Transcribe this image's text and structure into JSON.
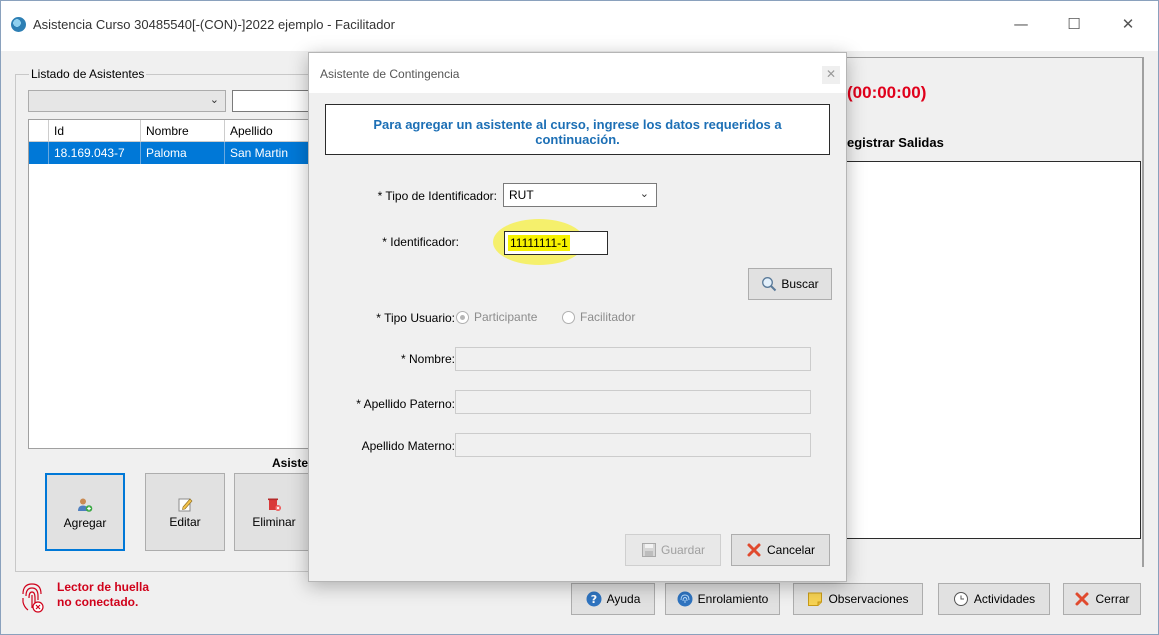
{
  "window": {
    "title": "Asistencia Curso 30485540[-(CON)-]2022 ejemplo - Facilitador",
    "controls": {
      "minimize": "—",
      "maximize": "☐",
      "close": "✕"
    }
  },
  "list_panel": {
    "legend": "Listado de Asistentes",
    "filter_value": "",
    "search_value": "",
    "columns": [
      "Id",
      "Nombre",
      "Apellido"
    ],
    "rows": [
      {
        "id": "18.169.043-7",
        "nombre": "Paloma",
        "apellido": "San Martin"
      }
    ],
    "section_label": "Asiste",
    "buttons": {
      "agregar": "Agregar",
      "editar": "Editar",
      "eliminar": "Eliminar"
    }
  },
  "right_panel": {
    "timer": "(00:00:00)",
    "heading": "egistrar Salidas"
  },
  "status": {
    "line1": "Lector de huella",
    "line2": "no conectado."
  },
  "bottom_buttons": {
    "ayuda": "Ayuda",
    "enrolamiento": "Enrolamiento",
    "observaciones": "Observaciones",
    "actividades": "Actividades",
    "cerrar": "Cerrar"
  },
  "dialog": {
    "title": "Asistente de Contingencia",
    "close": "✕",
    "info_line1": "Para agregar un asistente al curso, ingrese los datos requeridos a",
    "info_line2": "continuación.",
    "tipo_id_label": "* Tipo de Identificador:",
    "tipo_id_value": "RUT",
    "identificador_label": "* Identificador:",
    "identificador_value": "11111111-1",
    "buscar": "Buscar",
    "tipo_usuario_label": "* Tipo Usuario:",
    "radio_participante": "Participante",
    "radio_facilitador": "Facilitador",
    "nombre_label": "* Nombre:",
    "paterno_label": "* Apellido Paterno:",
    "materno_label": "Apellido Materno:",
    "guardar": "Guardar",
    "cancelar": "Cancelar"
  },
  "colors": {
    "selection": "#0078d7",
    "timer": "#e0001b",
    "info_text": "#1c6fb5",
    "highlight": "#f6f200"
  }
}
